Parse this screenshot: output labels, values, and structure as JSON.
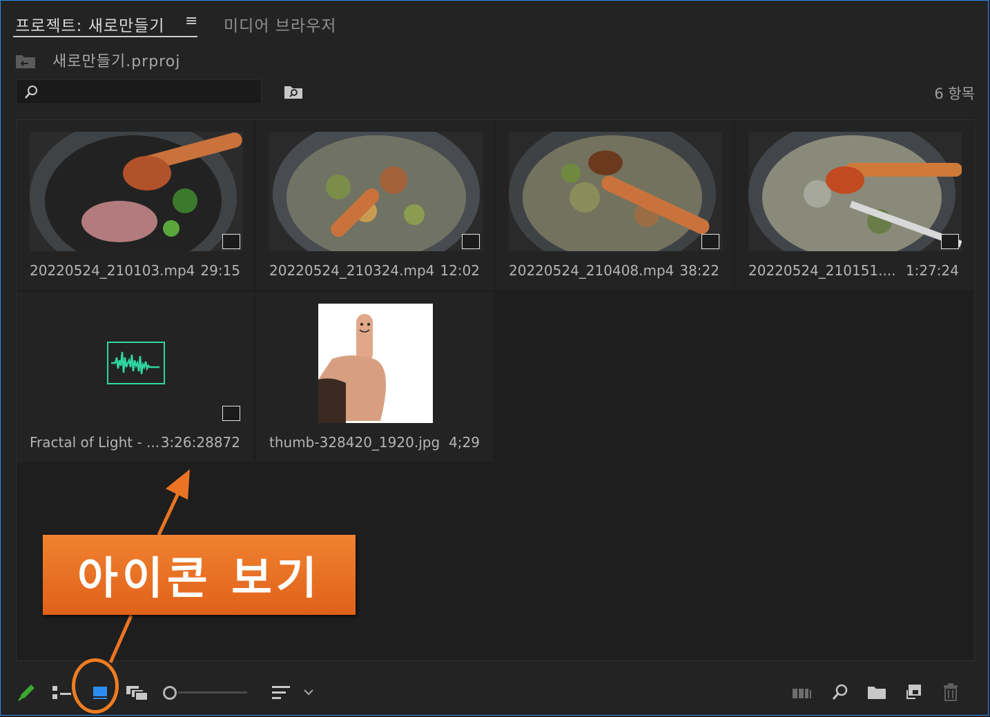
{
  "tabs": {
    "project": "프로젝트: 새로만들기",
    "menu_symbol": "≡",
    "media_browser": "미디어 브라우저"
  },
  "breadcrumb": {
    "project_file": "새로만들기.prproj"
  },
  "search": {
    "value": "",
    "placeholder": ""
  },
  "item_count": "6 항목",
  "items": [
    {
      "name": "20220524_210103.mp4",
      "duration": "29:15"
    },
    {
      "name": "20220524_210324.mp4",
      "duration": "12:02"
    },
    {
      "name": "20220524_210408.mp4",
      "duration": "38:22"
    },
    {
      "name": "20220524_210151....",
      "duration": "1:27:24"
    },
    {
      "name": "Fractal of Light - ...",
      "duration": "3:26:28872"
    },
    {
      "name": "thumb-328420_1920.jpg",
      "duration": "4;29"
    }
  ],
  "annotation": {
    "label": "아이콘 보기"
  },
  "colors": {
    "accent": "#2d8cf0",
    "callout": "#ea7424",
    "audio_wave": "#2fd6a0",
    "pencil": "#3aa82f"
  },
  "toolbar": {
    "icons": [
      "pencil-icon",
      "list-view-icon",
      "icon-view-icon",
      "freeform-view-icon",
      "zoom-slider",
      "sort-icon",
      "chevron-down-icon",
      "automate-sequence-icon",
      "find-icon",
      "new-bin-icon",
      "new-item-icon",
      "trash-icon"
    ]
  }
}
